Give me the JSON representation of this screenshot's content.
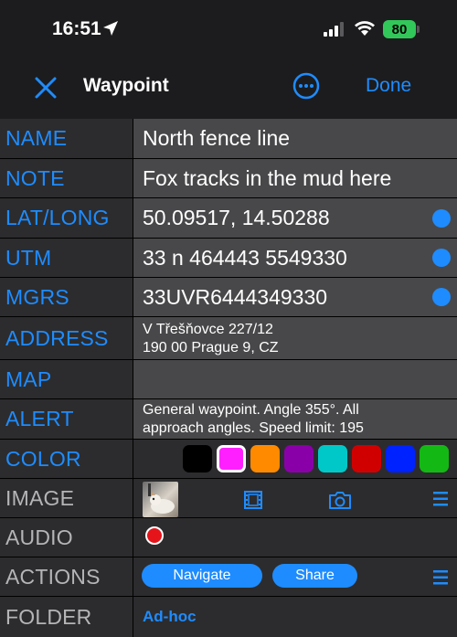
{
  "status": {
    "time": "16:51",
    "battery": "80"
  },
  "nav": {
    "title": "Waypoint",
    "done": "Done"
  },
  "rows": {
    "name": {
      "label": "NAME",
      "value": "North fence line"
    },
    "note": {
      "label": "NOTE",
      "value": "Fox tracks in the mud here"
    },
    "latlong": {
      "label": "LAT/LONG",
      "value": "50.09517, 14.50288"
    },
    "utm": {
      "label": "UTM",
      "value": "33 n 464443 5549330"
    },
    "mgrs": {
      "label": "MGRS",
      "value": "33UVR6444349330"
    },
    "address": {
      "label": "ADDRESS",
      "line1": "V Třešňovce 227/12",
      "line2": "190 00 Prague 9, CZ"
    },
    "map": {
      "label": "MAP"
    },
    "alert": {
      "label": "ALERT",
      "line1": "General waypoint. Angle 355°.  All",
      "line2": "approach angles. Speed limit: 195"
    },
    "color": {
      "label": "COLOR",
      "swatches": [
        "#000000",
        "#ff1fff",
        "#ff8a00",
        "#8a00a8",
        "#00c8c8",
        "#d10000",
        "#0022ff",
        "#14b814"
      ],
      "selected_index": 1
    },
    "image": {
      "label": "IMAGE"
    },
    "audio": {
      "label": "AUDIO"
    },
    "actions": {
      "label": "ACTIONS",
      "navigate": "Navigate",
      "share": "Share"
    },
    "folder": {
      "label": "FOLDER",
      "value": "Ad-hoc"
    }
  }
}
